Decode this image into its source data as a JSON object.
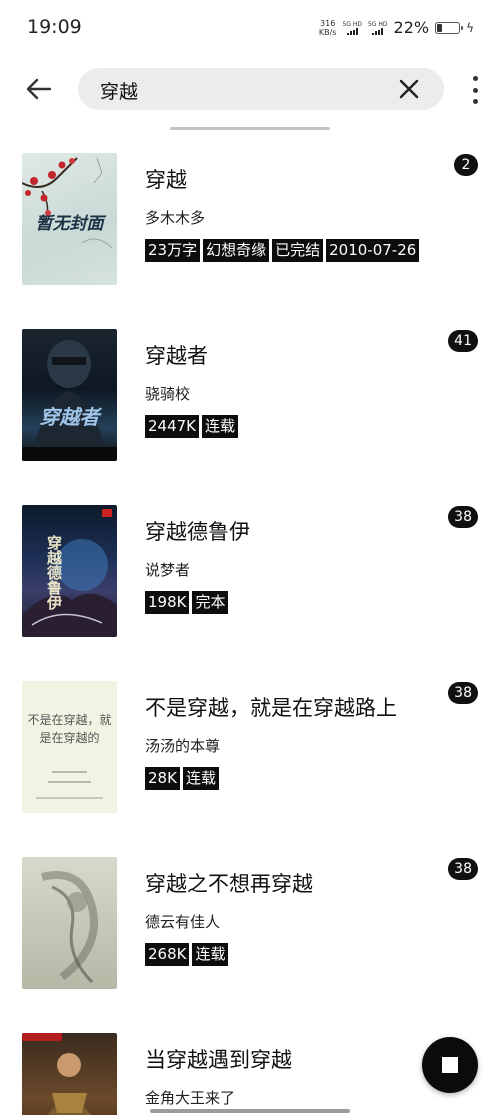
{
  "status_bar": {
    "time": "19:09",
    "net_speed_value": "316",
    "net_speed_unit": "KB/s",
    "sim1_label": "5G HD",
    "sim2_label": "5G HD",
    "battery_percent_text": "22%",
    "battery_level": 0.22
  },
  "search": {
    "query": "穿越"
  },
  "icons": {
    "back": "arrow-left-icon",
    "clear": "close-icon",
    "more": "more-vertical-icon",
    "stop": "stop-icon"
  },
  "books": [
    {
      "title": "穿越",
      "author": "多木木多",
      "tags": [
        "23万字",
        "幻想奇缘",
        "已完结",
        "2010-07-26"
      ],
      "badge": "2",
      "cover_text": "暂无封面"
    },
    {
      "title": "穿越者",
      "author": "骁骑校",
      "tags": [
        "2447K",
        "连载"
      ],
      "badge": "41",
      "cover_text": "穿越者"
    },
    {
      "title": "穿越德鲁伊",
      "author": "说梦者",
      "tags": [
        "198K",
        "完本"
      ],
      "badge": "38",
      "cover_text": "穿越德鲁伊"
    },
    {
      "title": "不是穿越，就是在穿越路上",
      "author": "汤汤的本尊",
      "tags": [
        "28K",
        "连载"
      ],
      "badge": "38",
      "cover_text": "不是在穿越，就是在穿越的"
    },
    {
      "title": "穿越之不想再穿越",
      "author": "德云有佳人",
      "tags": [
        "268K",
        "连载"
      ],
      "badge": "38",
      "cover_text": ""
    },
    {
      "title": "当穿越遇到穿越",
      "author": "金角大王来了",
      "tags": [],
      "badge": "",
      "cover_text": ""
    }
  ]
}
